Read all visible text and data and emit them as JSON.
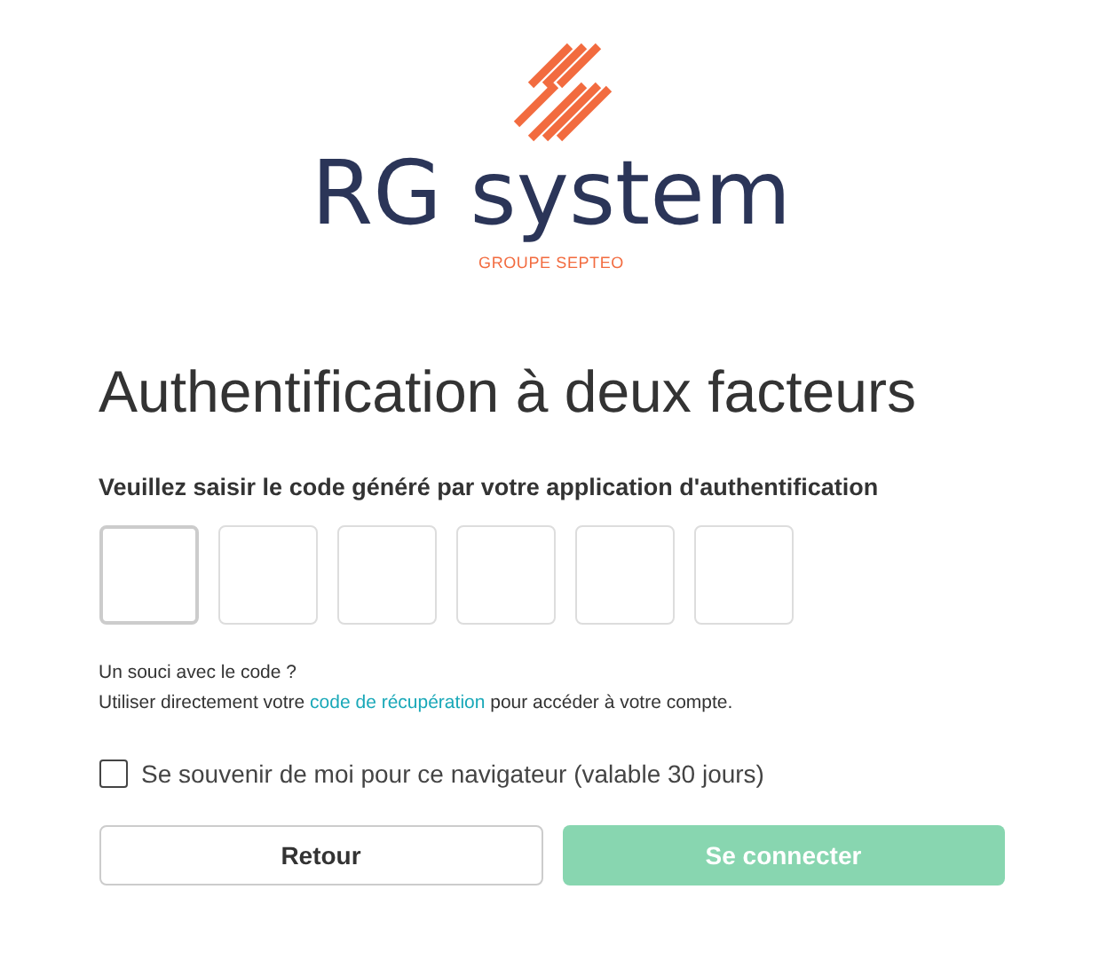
{
  "logo": {
    "name": "RG system",
    "tagline": "GROUPE SEPTEO"
  },
  "title": "Authentification à deux facteurs",
  "prompt": "Veuillez saisir le code généré par votre application d'authentification",
  "code_fields": [
    {
      "focused": true
    },
    {
      "focused": false
    },
    {
      "focused": false
    },
    {
      "focused": false
    },
    {
      "focused": false
    },
    {
      "focused": false
    }
  ],
  "help": {
    "question": "Un souci avec le code ?",
    "before": "Utiliser directement votre",
    "link": "code de récupération",
    "after": "pour accéder à votre compte."
  },
  "remember": {
    "label": "Se souvenir de moi pour ce navigateur (valable 30 jours)",
    "checked": false
  },
  "buttons": [
    {
      "label": "Retour",
      "kind": "secondary",
      "disabled": false
    },
    {
      "label": "Se connecter",
      "kind": "primary",
      "disabled": true
    }
  ]
}
